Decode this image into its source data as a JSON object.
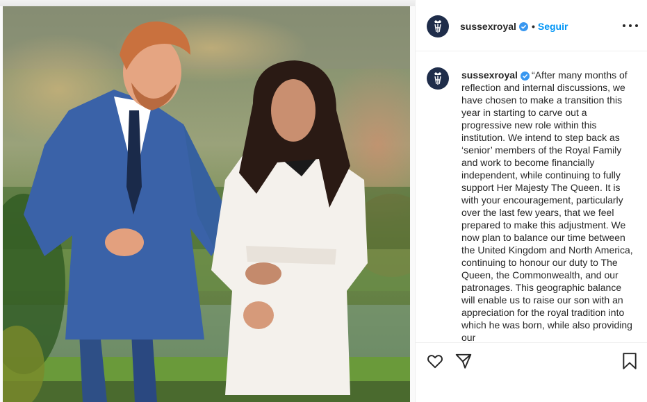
{
  "post": {
    "username": "sussexroyal",
    "dot": "•",
    "follow_label": "Seguir",
    "caption_username": "sussexroyal",
    "caption_text": "“After many months of reflection and internal discussions, we have chosen to make a transition this year in starting to carve out a progressive new role within this institution. We intend to step back as ‘senior’ members of the Royal Family and work to become financially independent, while continuing to fully support Her Majesty The Queen. It is with your encouragement, particularly over the last few years, that we feel prepared to make this adjustment. We now plan to balance our time between the United Kingdom and North America, continuing to honour our duty to The Queen, the Commonwealth, and our patronages. This geographic balance will enable us to raise our son with an appreciation for the royal tradition into which he was born, while also providing our"
  },
  "icons": {
    "avatar": "monogram-crest-icon",
    "verified": "verified-badge-icon",
    "more": "more-options-icon",
    "like": "heart-icon",
    "share": "paper-plane-icon",
    "save": "bookmark-icon"
  },
  "colors": {
    "follow": "#0095f6",
    "verified": "#3897f0",
    "avatar_bg": "#1f2d4a"
  }
}
